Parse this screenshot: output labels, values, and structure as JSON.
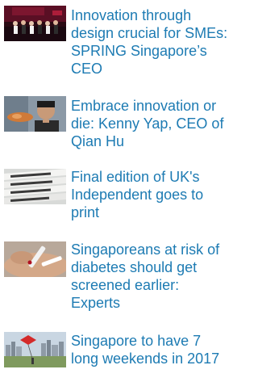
{
  "articles": [
    {
      "title": "Innovation through design crucial for SMEs: SPRING Singapore’s CEO",
      "thumbnail": "event-stage-photo"
    },
    {
      "title": "Embrace innovation or die: Kenny Yap, CEO of Qian Hu",
      "thumbnail": "man-portrait-photo"
    },
    {
      "title": "Final edition of UK's Independent goes to print",
      "thumbnail": "newspaper-stack-photo"
    },
    {
      "title": "Singaporeans at risk of diabetes should get screened earlier: Experts",
      "thumbnail": "blood-glucose-test-photo"
    },
    {
      "title": "Singapore to have 7 long weekends in 2017",
      "thumbnail": "city-skyline-kite-photo"
    }
  ],
  "colors": {
    "link": "#1d7bb3",
    "background": "#ffffff"
  }
}
